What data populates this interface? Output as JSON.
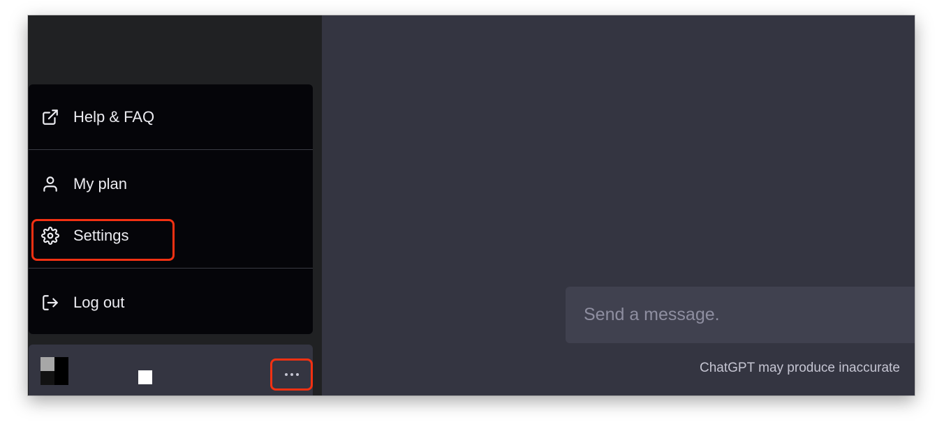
{
  "menu": {
    "items": [
      {
        "label": "Help & FAQ",
        "icon": "external-link-icon"
      },
      {
        "label": "My plan",
        "icon": "user-icon"
      },
      {
        "label": "Settings",
        "icon": "gear-icon"
      },
      {
        "label": "Log out",
        "icon": "logout-icon"
      }
    ]
  },
  "composer": {
    "placeholder": "Send a message."
  },
  "footer": {
    "disclaimer": "ChatGPT may produce inaccurate"
  },
  "profile": {
    "more_icon": "more-dots-icon"
  },
  "colors": {
    "sidebar": "#202123",
    "menu": "#050509",
    "main": "#343541",
    "composer": "#40414f",
    "highlight": "#f33112"
  }
}
